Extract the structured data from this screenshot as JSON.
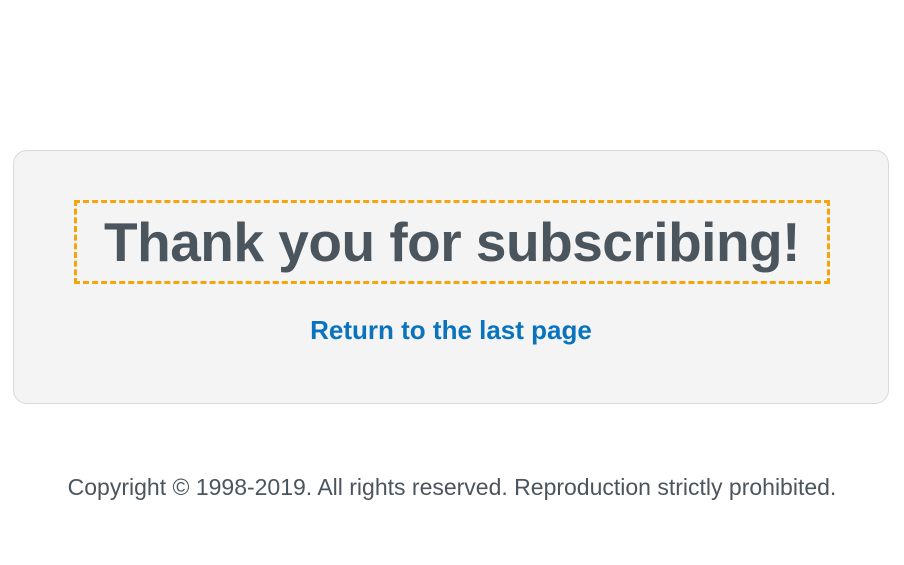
{
  "main": {
    "heading": "Thank you for subscribing!",
    "return_link": "Return to the last page"
  },
  "footer": {
    "copyright": "Copyright © 1998-2019. All rights reserved. Reproduction strictly prohibited."
  },
  "colors": {
    "card_background": "#f4f4f4",
    "heading_text": "#4b555e",
    "link": "#0a73be",
    "focus_outline": "#f5a50a"
  }
}
